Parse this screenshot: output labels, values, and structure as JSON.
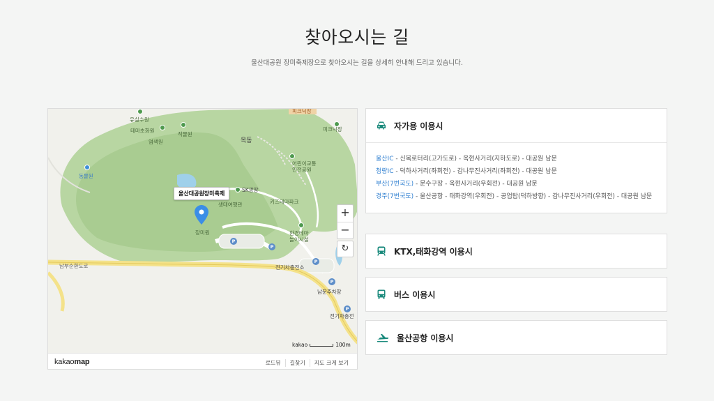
{
  "header": {
    "title": "찾아오시는 길",
    "subtitle": "울산대공원 장미축제장으로 찾아오시는 길을 상세히 안내해 드리고 있습니다."
  },
  "map": {
    "marker_label": "울산대공원장미축제",
    "pois": {
      "yusan": "유실수원",
      "themecho": "테마초화원",
      "yeomsaek": "염색원",
      "jakmul": "작물원",
      "okdong": "옥동",
      "picnic": "피크닉장",
      "kids": "어린이교통\n안전공원",
      "sk": "SK광장",
      "saengtae": "생태여행관",
      "kids_park": "키즈테마파크",
      "dongmul": "동물원",
      "jangmi": "장미원",
      "hwangyeong": "환경테마\n놀이시설",
      "jeongi1": "전기차충전소",
      "namun": "남문주차장",
      "jeongi2": "전기차충전",
      "road": "남부순환도로",
      "top_label": "피크닉장"
    },
    "scale_brand": "kakao",
    "scale_text": "100m",
    "zoom_in": "+",
    "zoom_out": "−",
    "refresh": "↻",
    "brand_regular": "kakao",
    "brand_bold": "map",
    "footer_links": [
      "로드뷰",
      "길찾기",
      "지도 크게 보기"
    ]
  },
  "panels": {
    "car": {
      "title": "자가용 이용시",
      "routes": [
        {
          "hl": "울산IC",
          "rest": " - 신복로터리(고가도로) - 옥현사거리(지하도로) - 대공원 남문"
        },
        {
          "hl": "청량IC",
          "rest": " - 덕하사거리(좌회전) - 감나무진사거리(좌회전) - 대공원 남문"
        },
        {
          "hl": "부산(7번국도)",
          "rest": " - 문수구장 - 옥현사거리(우회전) - 대공원 남문"
        },
        {
          "hl": "경주(7번국도)",
          "rest": " - 울산공항 - 태화강역(우회전) - 공업탑(덕하방향) - 감나무진사거리(우회전) - 대공원 남문"
        }
      ]
    },
    "ktx": {
      "title": "KTX,태화강역 이용시"
    },
    "bus": {
      "title": "버스 이용시"
    },
    "air": {
      "title": "울산공항 이용시"
    }
  },
  "colors": {
    "accent": "#1a8a7c",
    "link": "#2f7fd0",
    "park": "#b9d7a4"
  },
  "icons": {
    "car": "car-icon",
    "train": "train-icon",
    "bus": "bus-icon",
    "plane": "plane-icon"
  }
}
